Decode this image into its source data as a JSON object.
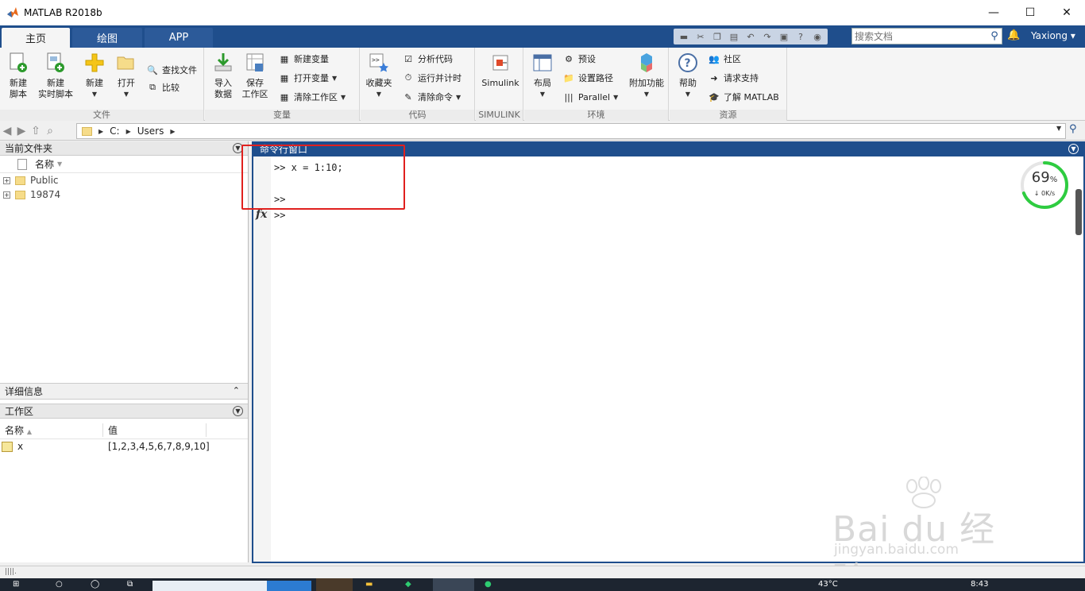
{
  "window": {
    "title": "MATLAB R2018b",
    "minimize": "—",
    "maximize": "☐",
    "close": "✕"
  },
  "tabs": [
    {
      "label": "主页"
    },
    {
      "label": "绘图"
    },
    {
      "label": "APP"
    }
  ],
  "search": {
    "placeholder": "搜索文档"
  },
  "user": {
    "name": "Yaxiong ▾"
  },
  "ribbon": {
    "file": {
      "label": "文件",
      "new_script": "新建\n脚本",
      "new_live_script": "新建\n实时脚本",
      "new": "新建",
      "open": "打开",
      "find_files": "查找文件",
      "compare": "比较"
    },
    "variable": {
      "label": "变量",
      "import": "导入\n数据",
      "save_ws": "保存\n工作区",
      "new_var": "新建变量",
      "open_var": "打开变量",
      "clear_ws": "清除工作区"
    },
    "code": {
      "label": "代码",
      "favorites": "收藏夹",
      "analyze": "分析代码",
      "run_time": "运行并计时",
      "clear_cmd": "清除命令"
    },
    "simulink": {
      "label": "SIMULINK",
      "button": "Simulink"
    },
    "env": {
      "label": "环境",
      "layout": "布局",
      "prefs": "预设",
      "set_path": "设置路径",
      "parallel": "Parallel",
      "addons": "附加功能"
    },
    "resources": {
      "label": "资源",
      "help": "帮助",
      "community": "社区",
      "support": "请求支持",
      "learn": "了解 MATLAB"
    }
  },
  "address": {
    "drive": "C:",
    "folder": "Users"
  },
  "current_folder": {
    "title": "当前文件夹",
    "col_name": "名称",
    "items": [
      {
        "name": "Public"
      },
      {
        "name": "19874"
      }
    ]
  },
  "details": {
    "title": "详细信息"
  },
  "workspace": {
    "title": "工作区",
    "col_name": "名称",
    "col_value": "值",
    "vars": [
      {
        "name": "x",
        "value": "[1,2,3,4,5,6,7,8,9,10]"
      }
    ]
  },
  "command_window": {
    "title": "命令行窗口",
    "lines": [
      ">> x = 1:10;",
      ">>"
    ],
    "prompt": ">>",
    "fx": "fx"
  },
  "gauge": {
    "percent": "69",
    "unit": "%",
    "rate": "0K/s",
    "percent_value": 69
  },
  "watermark": {
    "brand": "Bai du 经验",
    "url": "jingyan.baidu.com"
  },
  "taskbar": {
    "temp": "43°C",
    "time": "8:43"
  },
  "colors": {
    "accent": "#1f4e8c",
    "highlight": "#e0201e",
    "gauge": "#2ecc40"
  }
}
